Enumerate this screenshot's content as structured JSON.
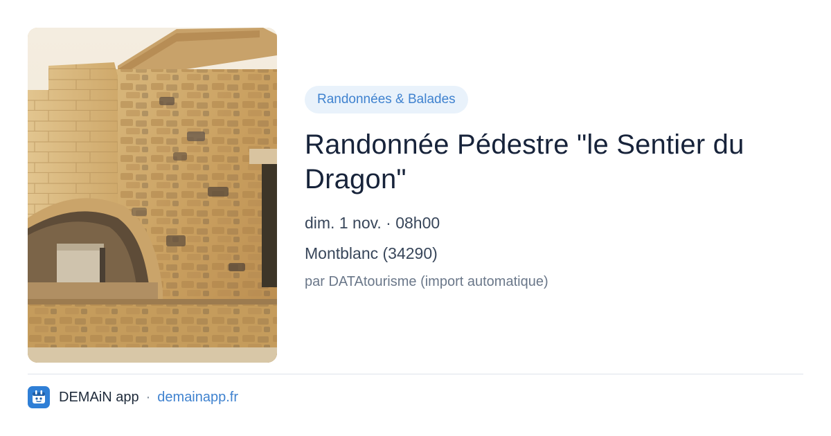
{
  "category": "Randonnées & Balades",
  "title": "Randonnée Pédestre \"le Sentier du Dragon\"",
  "date_time": "dim. 1 nov. · 08h00",
  "location": "Montblanc (34290)",
  "author": "par DATAtourisme (import automatique)",
  "footer": {
    "app_name": "DEMAiN app",
    "separator": "·",
    "domain": "demainapp.fr",
    "logo_icon": "demain-calendar-icon"
  },
  "photo": {
    "subject": "stone-building-arch-photo"
  },
  "colors": {
    "accent": "#3f82cf",
    "pill_bg": "#e9f2fb",
    "logo_bg": "#2f7fd6"
  }
}
